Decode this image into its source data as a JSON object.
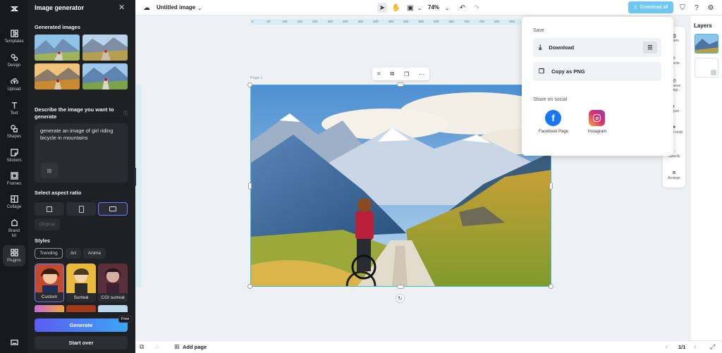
{
  "rail": {
    "items": [
      {
        "label": "Templates"
      },
      {
        "label": "Design"
      },
      {
        "label": "Upload"
      },
      {
        "label": "Text"
      },
      {
        "label": "Shapes"
      },
      {
        "label": "Stickers"
      },
      {
        "label": "Frames"
      },
      {
        "label": "Collage"
      },
      {
        "label": "Brand kit"
      },
      {
        "label": "Plugins"
      }
    ]
  },
  "panel": {
    "title": "Image generator",
    "generated_label": "Generated images",
    "describe_label": "Describe the image you want to generate",
    "prompt_text": "generate an image of girl riding bicycle in mountains",
    "aspect_label": "Select aspect ratio",
    "original_label": "Original",
    "styles_label": "Styles",
    "style_tabs": [
      "Trending",
      "Art",
      "Anime"
    ],
    "styles": [
      "Custom",
      "Surreal",
      "CGI surreal"
    ],
    "generate_label": "Generate",
    "free_badge": "Free",
    "start_over_label": "Start over"
  },
  "topbar": {
    "doc_title": "Untitled image",
    "zoom": "74%",
    "download_all": "Download all"
  },
  "canvas": {
    "page_label": "Page 1",
    "ruler_ticks": [
      "0",
      "50",
      "100",
      "150",
      "200",
      "250",
      "300",
      "350",
      "400",
      "450",
      "500",
      "550",
      "600",
      "650",
      "700",
      "750",
      "800",
      "850",
      "900",
      "950",
      "1000"
    ]
  },
  "popup": {
    "save_label": "Save",
    "download_label": "Download",
    "copy_png_label": "Copy as PNG",
    "share_label": "Share on social",
    "facebook_label": "Facebook Page",
    "instagram_label": "Instagram"
  },
  "righttools": {
    "items": [
      "Filters",
      "Effects",
      "Remove backgr...",
      "Adjust",
      "Smart tools",
      "Opacity",
      "Arrange"
    ]
  },
  "layers": {
    "title": "Layers"
  },
  "bottombar": {
    "add_page": "Add page",
    "page_count": "1/1"
  },
  "colors": {
    "accent": "#5b5cf3",
    "download_all_bg": "#6ec9f2",
    "selection": "#3dbde6"
  }
}
